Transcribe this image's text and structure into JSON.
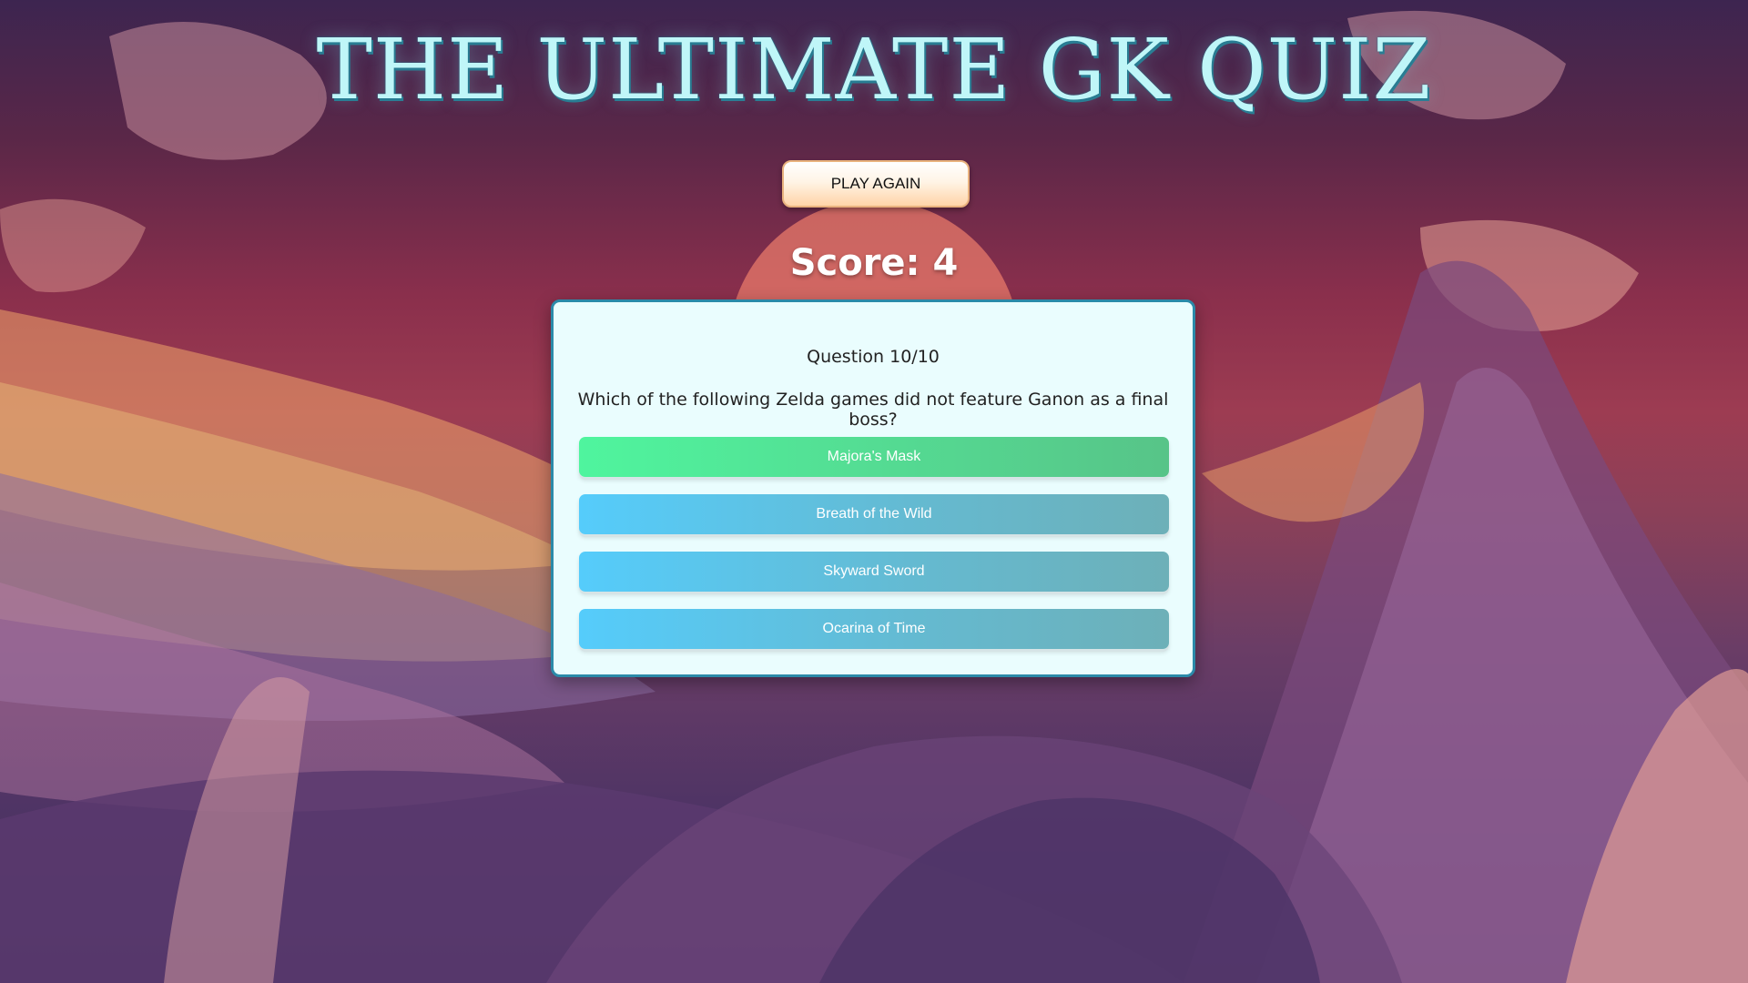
{
  "header": {
    "title": "THE ULTIMATE GK QUIZ"
  },
  "controls": {
    "play_again_label": "PLAY AGAIN"
  },
  "score": {
    "text": "Score: 4"
  },
  "quiz": {
    "question_number": "Question 10/10",
    "question_text": "Which of the following Zelda games did not feature Ganon as a final boss?",
    "options": [
      {
        "label": "Majora's Mask",
        "state": "correct"
      },
      {
        "label": "Breath of the Wild",
        "state": "default"
      },
      {
        "label": "Skyward Sword",
        "state": "default"
      },
      {
        "label": "Ocarina of Time",
        "state": "default"
      }
    ]
  },
  "colors": {
    "title": "#bff6f8",
    "card_background": "#eafdfe",
    "card_border": "#2b8aa9",
    "correct_option": "#4ff59e",
    "default_option": "#55ccfb",
    "play_again_bg": "#ffd4a8"
  }
}
